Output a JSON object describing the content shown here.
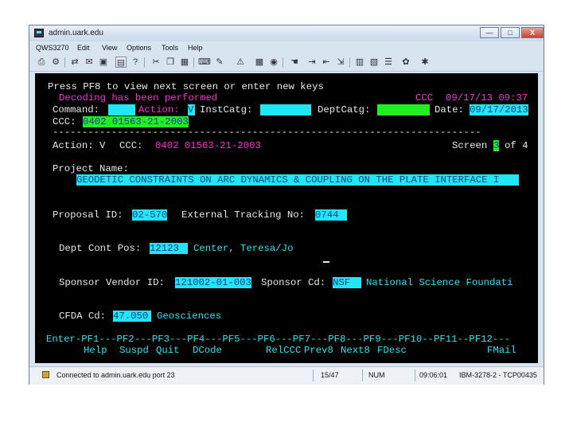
{
  "window": {
    "title": "admin.uark.edu",
    "min_label": "—",
    "max_label": "□",
    "close_label": "X"
  },
  "menu": [
    "QWS3270",
    "Edit",
    "View",
    "Options",
    "Tools",
    "Help"
  ],
  "toolbar_icons": [
    "print-icon",
    "settings-icon",
    "transfer-icon",
    "mail-icon",
    "save-icon",
    "screen-icon",
    "help-icon",
    "cut-icon",
    "copy-icon",
    "paste-icon",
    "keyboard-icon",
    "macro-icon",
    "warning-icon",
    "terminal-icon",
    "record-icon",
    "hand-icon",
    "send-icon",
    "receive-icon",
    "edit-icon",
    "print-screen-icon",
    "map-icon",
    "list-icon",
    "tools-icon",
    "bug-icon"
  ],
  "terminal": {
    "prompt": "Press PF8 to view next screen or enter new keys",
    "message": "Decoding has been performed",
    "header_ccc_label": "CCC",
    "header_datetime": "09/17/13 09:37",
    "command_label": "Command:",
    "command_value": "",
    "action_label": "Action:",
    "action_value": "V",
    "instcatg_label": "InstCatg:",
    "instcatg_value": "",
    "deptcatg_label": "DeptCatg:",
    "deptcatg_value": "",
    "date_label": "Date:",
    "date_value": "09/17/2013",
    "ccc_label": "CCC:",
    "ccc_value": "0402 01563-21-2003",
    "divider": "-------------------------------------------------------------------------",
    "action2_label": "Action: V",
    "ccc2_label": "CCC:",
    "ccc2_value": "0402 01563-21-2003",
    "screen_label": "Screen",
    "screen_current": "3",
    "screen_of": "of 4",
    "project_name_label": "Project Name:",
    "project_name_value": "GEODETIC CONSTRAINTS ON ARC DYNAMICS & COUPLING ON THE PLATE INTERFACE I",
    "proposal_id_label": "Proposal ID:",
    "proposal_id_value": "02-570",
    "external_tracking_label": "External Tracking No:",
    "external_tracking_value": "0744",
    "dept_cont_pos_label": "Dept Cont Pos:",
    "dept_cont_pos_value": "12123",
    "dept_cont_name": "Center, Teresa/Jo",
    "sponsor_vendor_label": "Sponsor Vendor ID:",
    "sponsor_vendor_value": "121002-01-003",
    "sponsor_cd_label": "Sponsor Cd:",
    "sponsor_cd_value": "NSF",
    "sponsor_name": "National Science Foundati",
    "cfda_label": "CFDA Cd:",
    "cfda_value": "47.050",
    "cfda_name": "Geosciences",
    "pf_line": "Enter-PF1---PF2---PF3---PF4---PF5---PF6---PF7---PF8---PF9---PF10--PF11--PF12---",
    "pf_keys": {
      "pf1": "Help",
      "pf2": "Suspd",
      "pf3": "Quit",
      "pf4": "DCode",
      "pf6": "RelCCC",
      "pf7": "Prev8",
      "pf8": "Next8",
      "pf9": "FDesc",
      "pf12": "FMail"
    }
  },
  "status": {
    "connection": "Connected to admin.uark.edu port 23",
    "cursor_pos": "15/47",
    "mode": "NUM",
    "time": "09:06:01",
    "terminal_id": "IBM-3278-2 - TCP00435"
  }
}
